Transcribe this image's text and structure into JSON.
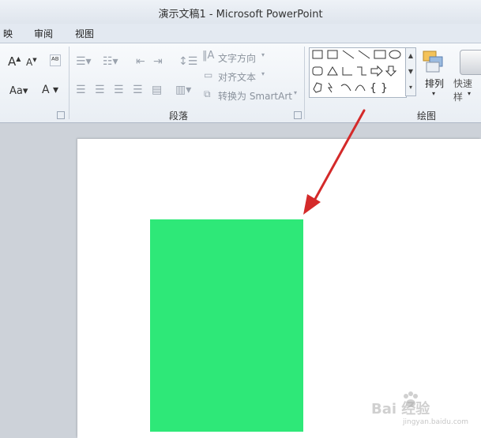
{
  "window": {
    "title": "演示文稿1 - Microsoft PowerPoint"
  },
  "menu": [
    "映",
    "审阅",
    "视图"
  ],
  "ribbon": {
    "paragraph": {
      "label": "段落",
      "text_direction": "文字方向",
      "align_text": "对齐文本",
      "convert_smartart": "转换为 SmartArt"
    },
    "drawing": {
      "label": "绘图",
      "arrange": "排列",
      "quick_styles": "快速样"
    }
  },
  "watermark": {
    "text": "Bai 经验",
    "sub": "jingyan.baidu.com"
  },
  "colors": {
    "shape_fill": "#2ee878",
    "arrow": "#d42a2a"
  }
}
